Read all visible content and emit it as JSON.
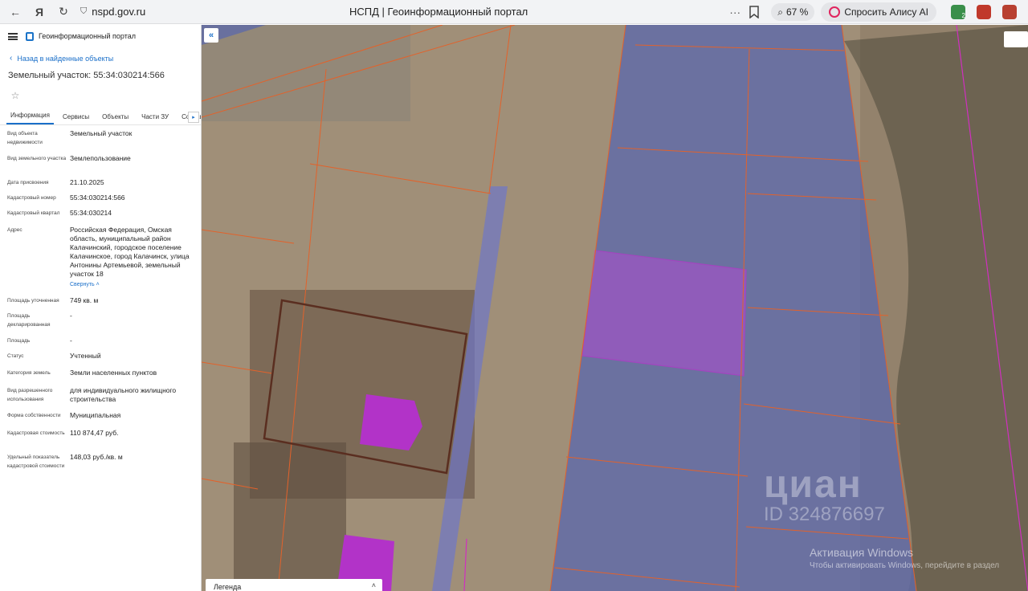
{
  "browser": {
    "url": "nspd.gov.ru",
    "tab_title": "НСПД | Геоинформационный портал",
    "zoom": "67 %",
    "alisa": "Спросить Алису AI",
    "ext_badge": "2"
  },
  "sidebar": {
    "portal_name": "Геоинформационный портал",
    "back_label": "Назад в найденные объекты",
    "title": "Земельный участок: 55:34:030214:566",
    "tabs": [
      "Информация",
      "Сервисы",
      "Объекты",
      "Части ЗУ",
      "Состав"
    ],
    "properties": [
      {
        "label": "Вид объекта недвижимости",
        "value": "Земельный участок"
      },
      {
        "label": "Вид земельного участка",
        "value": "Землепользование"
      },
      {
        "label": "Дата присвоения",
        "value": "21.10.2025"
      },
      {
        "label": "Кадастровый номер",
        "value": "55:34:030214:566"
      },
      {
        "label": "Кадастровый квартал",
        "value": "55:34:030214"
      },
      {
        "label": "Адрес",
        "value": "Российская Федерация, Омская область, муниципальный район Калачинский, городское поселение Калачинское, город Калачинск, улица Антонины Артемьевой, земельный участок 18"
      },
      {
        "label": "Площадь уточненная",
        "value": "749 кв. м"
      },
      {
        "label": "Площадь декларированная",
        "value": "-"
      },
      {
        "label": "Площадь",
        "value": "-"
      },
      {
        "label": "Статус",
        "value": "Учтенный"
      },
      {
        "label": "Категория земель",
        "value": "Земли населенных пунктов"
      },
      {
        "label": "Вид разрешенного использования",
        "value": "для индивидуального жилищного строительства"
      },
      {
        "label": "Форма собственности",
        "value": "Муниципальная"
      },
      {
        "label": "Кадастровая стоимость",
        "value": "110 874,47 руб."
      },
      {
        "label": "Удельный показатель кадастровой стоимости",
        "value": "148,03 руб./кв. м"
      }
    ],
    "collapse_label": "Свернуть"
  },
  "map": {
    "legend_label": "Легенда",
    "watermark_logo": "циан",
    "watermark_id": "ID 324876697",
    "win_activation_title": "Активация Windows",
    "win_activation_text": "Чтобы активировать Windows, перейдите в раздел"
  },
  "colors": {
    "accent": "#1a6fc9",
    "boundary": "#e2622b",
    "zone_blue": "#6a74b8",
    "selected_parcel": "#a552c8",
    "building": "#b233c8"
  }
}
